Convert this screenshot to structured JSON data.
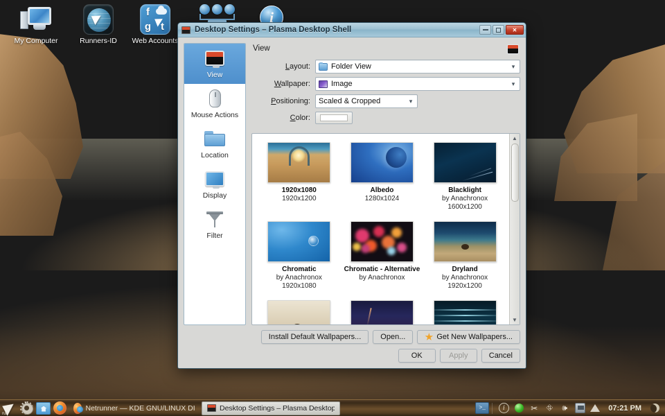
{
  "desktop": {
    "icons": [
      {
        "label": "My Computer",
        "icon": "computer-icon"
      },
      {
        "label": "Runners-ID",
        "icon": "globe-cursor-icon"
      },
      {
        "label": "Web Accounts",
        "icon": "web-accounts-icon"
      }
    ]
  },
  "dialog": {
    "title": "Desktop Settings – Plasma Desktop Shell",
    "title_icon": "monitor-icon",
    "window_buttons": {
      "minimize": "minimize-button",
      "maximize": "maximize-button",
      "close": "close-button"
    },
    "sidebar": {
      "items": [
        {
          "label": "View",
          "icon": "monitor-icon",
          "selected": true
        },
        {
          "label": "Mouse Actions",
          "icon": "mouse-icon",
          "selected": false
        },
        {
          "label": "Location",
          "icon": "folder-icon",
          "selected": false
        },
        {
          "label": "Display",
          "icon": "display-icon",
          "selected": false
        },
        {
          "label": "Filter",
          "icon": "filter-icon",
          "selected": false
        }
      ]
    },
    "pane": {
      "title": "View",
      "header_icon": "monitor-icon",
      "fields": {
        "layout": {
          "label": "Layout:",
          "accel": "L",
          "value": "Folder View",
          "icon": "folder-icon"
        },
        "wallpaper": {
          "label": "Wallpaper:",
          "accel": "W",
          "value": "Image",
          "icon": "image-icon"
        },
        "positioning": {
          "label": "Positioning:",
          "accel": "P",
          "value": "Scaled & Cropped"
        },
        "color": {
          "label": "Color:",
          "accel": "C",
          "value": "#ffffff"
        }
      },
      "wallpapers": [
        {
          "name": "1920x1080",
          "author": "",
          "size": "1920x1200",
          "art": "t-desert"
        },
        {
          "name": "Albedo",
          "author": "",
          "size": "1280x1024",
          "art": "t-albedo"
        },
        {
          "name": "Blacklight",
          "author": "by Anachronox",
          "size": "1600x1200",
          "art": "t-black"
        },
        {
          "name": "Chromatic",
          "author": "by Anachronox",
          "size": "1920x1080",
          "art": "t-chromatic"
        },
        {
          "name": "Chromatic - Alternative",
          "author": "by Anachronox",
          "size": "",
          "art": "t-chromalt"
        },
        {
          "name": "Dryland",
          "author": "by Anachronox",
          "size": "1920x1200",
          "art": "t-dryland"
        },
        {
          "name": "",
          "author": "",
          "size": "",
          "art": "t-sand2"
        },
        {
          "name": "",
          "author": "",
          "size": "",
          "art": "t-night"
        },
        {
          "name": "",
          "author": "",
          "size": "",
          "art": "t-water"
        }
      ],
      "buttons": {
        "install_default": "Install Default Wallpapers...",
        "open": "Open...",
        "get_new": "Get New Wallpapers...",
        "ok": "OK",
        "apply": "Apply",
        "cancel": "Cancel"
      }
    }
  },
  "taskbar": {
    "launcher_label": "run",
    "tasks": [
      {
        "label": "Netrunner — KDE GNU/LINUX DISTRIBUT",
        "active": false
      },
      {
        "label": "Desktop Settings – Plasma Desktop Shell",
        "active": true
      }
    ],
    "clock": "07:21 PM",
    "tray_icons": [
      "terminal-icon",
      "info-icon",
      "status-green-icon",
      "klipper-scissors-icon",
      "connection-icon",
      "volume-icon",
      "network-icon",
      "show-hidden-icon",
      "moon-icon"
    ]
  }
}
